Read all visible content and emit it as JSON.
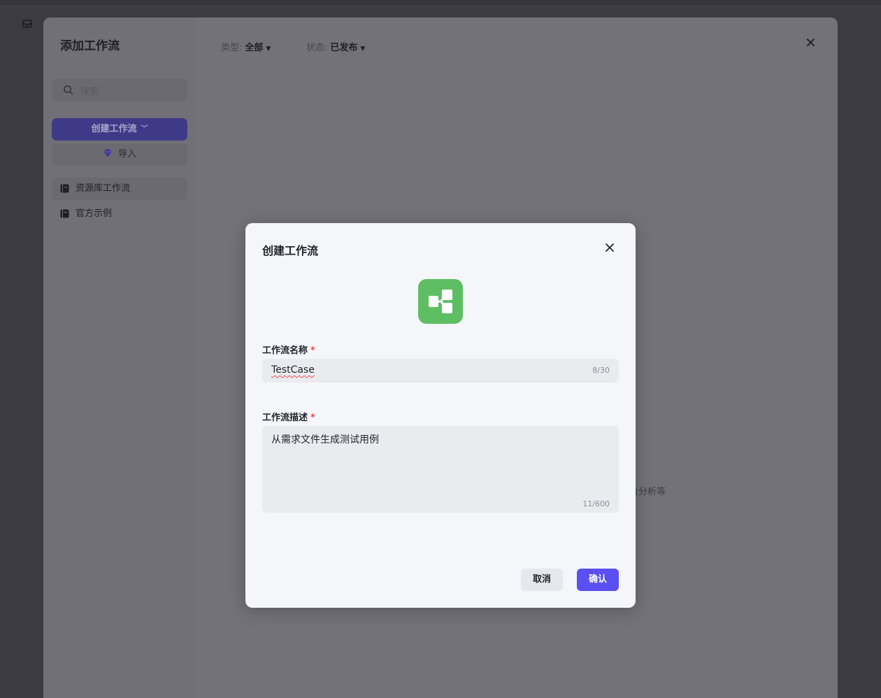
{
  "outer": {
    "title": "添加工作流",
    "search_placeholder": "搜索",
    "create_button": "创建工作流",
    "import_button": "导入",
    "sidebar_items": [
      {
        "label": "资源库工作流",
        "active": true
      },
      {
        "label": "官方示例",
        "active": false
      }
    ],
    "filters": [
      {
        "label": "类型:",
        "value": "全部"
      },
      {
        "label": "状态:",
        "value": "已发布"
      }
    ],
    "background_text": "告分析等"
  },
  "dialog": {
    "title": "创建工作流",
    "icon": "workflow-icon",
    "icon_color": "#5ebe63",
    "name_field": {
      "label": "工作流名称",
      "required_mark": "*",
      "value": "TestCase",
      "count": "8/30"
    },
    "desc_field": {
      "label": "工作流描述",
      "required_mark": "*",
      "value": "从需求文件生成测试用例",
      "count": "11/600"
    },
    "cancel_label": "取消",
    "confirm_label": "确认",
    "accent_color": "#5a4ff0"
  }
}
